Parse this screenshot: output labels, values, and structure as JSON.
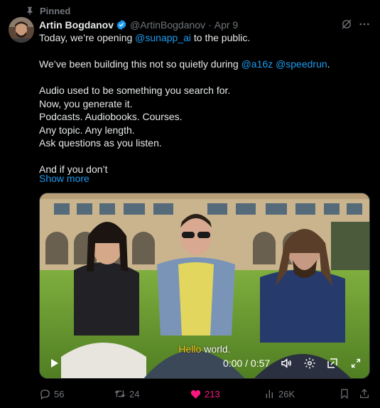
{
  "pinned_label": "Pinned",
  "author": {
    "name": "Artin Bogdanov",
    "handle": "@ArtinBogdanov",
    "separator": "·",
    "date": "Apr 9"
  },
  "tweet": {
    "line1_pre": "Today, we’re opening ",
    "line1_link": "@sunapp_ai",
    "line1_post": " to the public.",
    "line2_pre": "We’ve been building this not so quietly during ",
    "line2_link1": "@a16z",
    "line2_mid": " ",
    "line2_link2": "@speedrun",
    "line2_post": ".",
    "line3": "Audio used to be something you search for.",
    "line4": "Now, you generate it.",
    "line5": "Podcasts. Audiobooks. Courses.",
    "line6": "Any topic. Any length.",
    "line7": "Ask questions as you listen.",
    "line8": "And if you don’t",
    "show_more": "Show more"
  },
  "video": {
    "caption_highlight": "Hello",
    "caption_rest": " world.",
    "time": "0:00 / 0:57",
    "progress": 0
  },
  "actions": {
    "replies": "56",
    "reposts": "24",
    "likes": "213",
    "views": "26K"
  },
  "colors": {
    "accent": "#1d9bf0",
    "like": "#f91880",
    "muted": "#71767b",
    "caption_highlight": "#f5c518"
  },
  "icons": [
    "pin-icon",
    "verified-badge-icon",
    "grok-icon",
    "more-icon",
    "play-icon",
    "volume-icon",
    "settings-icon",
    "pip-icon",
    "fullscreen-icon",
    "reply-icon",
    "repost-icon",
    "heart-icon",
    "views-icon",
    "bookmark-icon",
    "share-icon"
  ]
}
